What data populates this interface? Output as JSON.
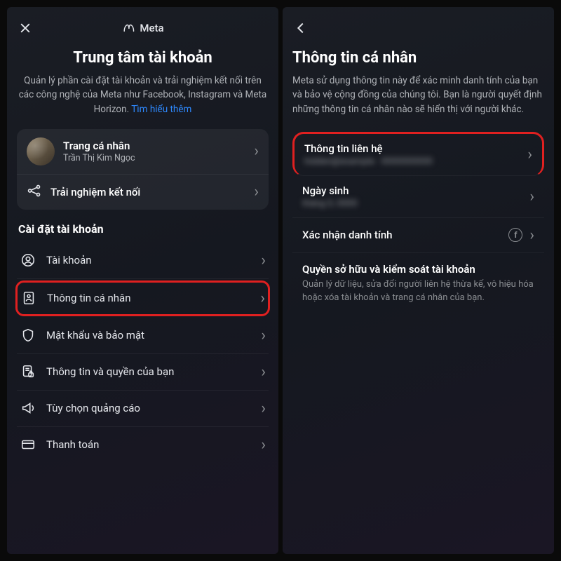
{
  "left": {
    "brand": "Meta",
    "title": "Trung tâm tài khoản",
    "desc_a": "Quản lý phần cài đặt tài khoản và trải nghiệm kết nối trên các công nghệ của Meta như Facebook, Instagram và Meta Horizon. ",
    "desc_link": "Tìm hiểu thêm",
    "profile": {
      "label": "Trang cá nhân",
      "name": "Trần Thị Kim Ngọc"
    },
    "connected_label": "Trải nghiệm kết nối",
    "section_label": "Cài đặt tài khoản",
    "items": [
      {
        "label": "Tài khoản"
      },
      {
        "label": "Thông tin cá nhân"
      },
      {
        "label": "Mật khẩu và bảo mật"
      },
      {
        "label": "Thông tin và quyền của bạn"
      },
      {
        "label": "Tùy chọn quảng cáo"
      },
      {
        "label": "Thanh toán"
      }
    ]
  },
  "right": {
    "title": "Thông tin cá nhân",
    "desc": "Meta sử dụng thông tin này để xác minh danh tính của bạn và bảo vệ cộng đồng của chúng tôi. Bạn là người quyết định những thông tin cá nhân nào sẽ hiển thị với người khác.",
    "rows": {
      "contact": {
        "label": "Thông tin liên hệ",
        "sub": "hidden@example · 0000000000"
      },
      "dob": {
        "label": "Ngày sinh",
        "sub": "tháng 0, 0000"
      },
      "identity": {
        "label": "Xác nhận danh tính"
      },
      "ownership": {
        "label": "Quyền sở hữu và kiểm soát tài khoản",
        "sub": "Quản lý dữ liệu, sửa đổi người liên hệ thừa kế, vô hiệu hóa hoặc xóa tài khoản và trang cá nhân của bạn."
      }
    },
    "fb_letter": "f"
  }
}
